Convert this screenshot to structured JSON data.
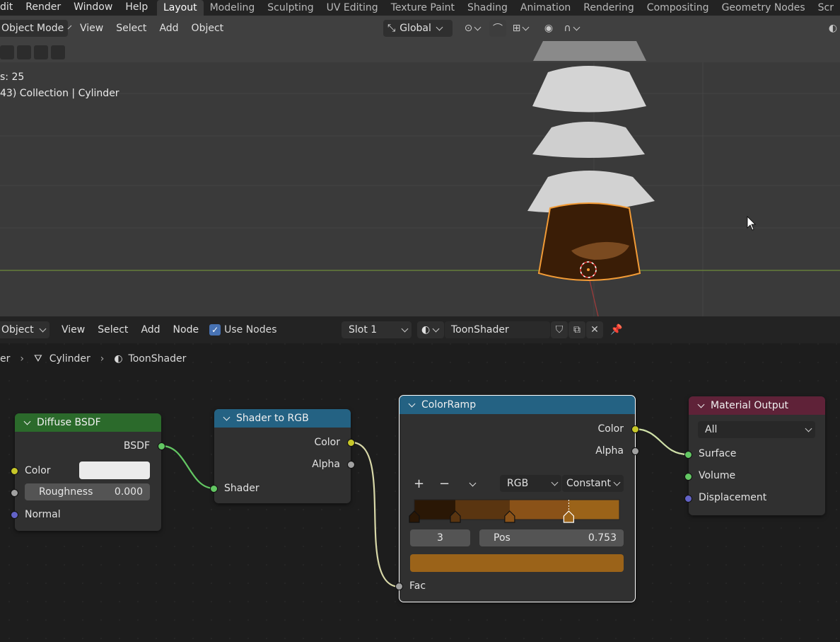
{
  "topbar": {
    "menus": [
      "dit",
      "Render",
      "Window",
      "Help"
    ],
    "workspaces": [
      "Layout",
      "Modeling",
      "Sculpting",
      "UV Editing",
      "Texture Paint",
      "Shading",
      "Animation",
      "Rendering",
      "Compositing",
      "Geometry Nodes",
      "Scr"
    ],
    "active_workspace": "Layout"
  },
  "viewport": {
    "mode": "Object Mode",
    "menus": [
      "View",
      "Select",
      "Add",
      "Object"
    ],
    "transform_orientation": "Global",
    "info_line1": "s: 25",
    "info_line2": "43) Collection | Cylinder"
  },
  "node_editor": {
    "object_dropdown": "Object",
    "menus": [
      "View",
      "Select",
      "Add",
      "Node"
    ],
    "use_nodes_label": "Use Nodes",
    "use_nodes_checked": true,
    "slot": "Slot 1",
    "material_name": "ToonShader",
    "breadcrumb": [
      "er",
      "Cylinder",
      "ToonShader"
    ]
  },
  "nodes": {
    "diffuse": {
      "title": "Diffuse BSDF",
      "output": "BSDF",
      "color_label": "Color",
      "color_value": "#ebebeb",
      "roughness_label": "Roughness",
      "roughness_value": "0.000",
      "normal_label": "Normal"
    },
    "shader_to_rgb": {
      "title": "Shader to RGB",
      "out_color": "Color",
      "out_alpha": "Alpha",
      "in_shader": "Shader"
    },
    "colorramp": {
      "title": "ColorRamp",
      "out_color": "Color",
      "out_alpha": "Alpha",
      "add_btn": "+",
      "remove_btn": "−",
      "color_mode": "RGB",
      "interpolation": "Constant",
      "active_index": "3",
      "pos_label": "Pos",
      "pos_value": "0.753",
      "active_color": "#9b6319",
      "stops": [
        {
          "pos": 0.0,
          "color": "#2a1705"
        },
        {
          "pos": 0.2,
          "color": "#5a3510"
        },
        {
          "pos": 0.465,
          "color": "#8a5218"
        },
        {
          "pos": 0.753,
          "color": "#9b6319"
        }
      ],
      "in_fac": "Fac"
    },
    "material_output": {
      "title": "Material Output",
      "target": "All",
      "in_surface": "Surface",
      "in_volume": "Volume",
      "in_displacement": "Displacement"
    }
  },
  "colors": {
    "shader_header": "#2b6a2b",
    "converter_header": "#246283",
    "output_header": "#5f2238",
    "selected_outline": "#ffffff",
    "active_object": "#f29b36"
  }
}
